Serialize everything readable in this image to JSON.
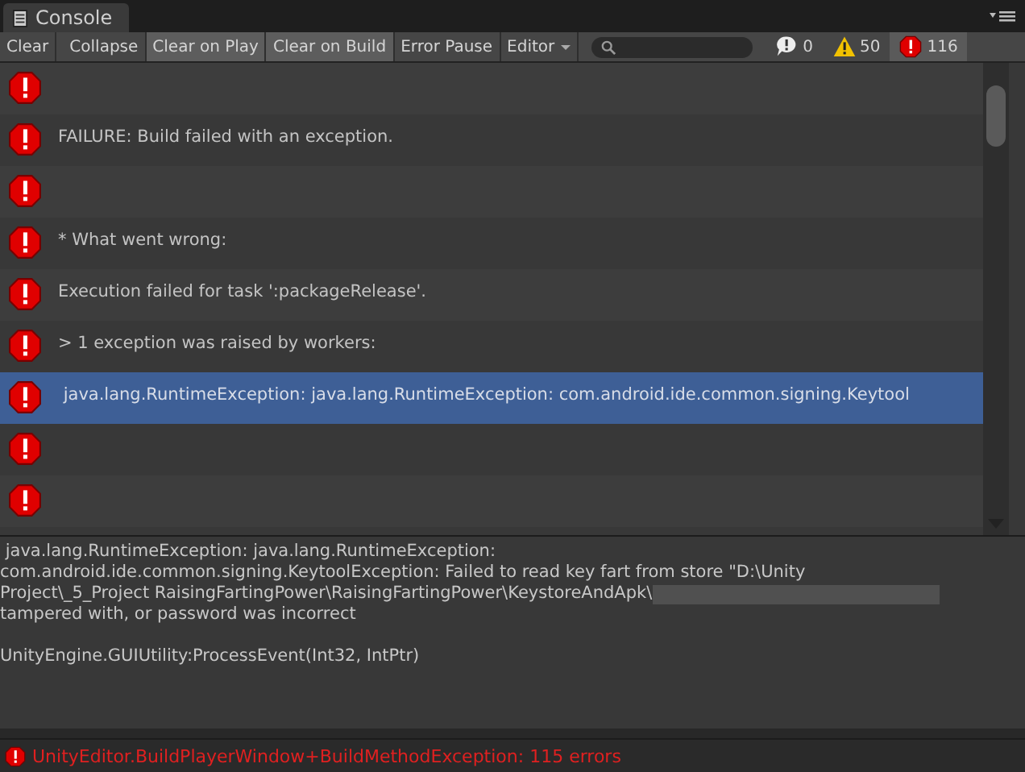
{
  "window": {
    "title": "Console"
  },
  "toolbar": {
    "buttons": [
      {
        "label": "Clear",
        "kind": "button",
        "selected": false
      },
      {
        "label": "Collapse",
        "kind": "toggle",
        "selected": false
      },
      {
        "label": "Clear on Play",
        "kind": "toggle",
        "selected": true
      },
      {
        "label": "Clear on Build",
        "kind": "toggle",
        "selected": true
      },
      {
        "label": "Error Pause",
        "kind": "toggle",
        "selected": false
      },
      {
        "label": "Editor",
        "kind": "dropdown",
        "selected": false
      }
    ],
    "counters": [
      {
        "kind": "info",
        "count": "0",
        "selected": false
      },
      {
        "kind": "warning",
        "count": "50",
        "selected": false
      },
      {
        "kind": "error",
        "count": "116",
        "selected": true
      }
    ]
  },
  "log": {
    "rows": [
      {
        "kind": "error",
        "message": "",
        "selected": false
      },
      {
        "kind": "error",
        "message": "FAILURE: Build failed with an exception.",
        "selected": false
      },
      {
        "kind": "error",
        "message": "",
        "selected": false
      },
      {
        "kind": "error",
        "message": "* What went wrong:",
        "selected": false
      },
      {
        "kind": "error",
        "message": "Execution failed for task ':packageRelease'.",
        "selected": false
      },
      {
        "kind": "error",
        "message": "> 1 exception was raised by workers:",
        "selected": false
      },
      {
        "kind": "error",
        "message": " java.lang.RuntimeException: java.lang.RuntimeException: com.android.ide.common.signing.Keytool",
        "selected": true
      },
      {
        "kind": "error",
        "message": "",
        "selected": false
      },
      {
        "kind": "error",
        "message": "",
        "selected": false
      }
    ]
  },
  "detail": {
    "paragraphs": [
      [
        {
          "text": " java.lang.RuntimeException: java.lang.RuntimeException:",
          "redacted": false
        },
        {
          "text": "com.android.ide.common.signing.KeytoolException: Failed to read key fart from store \"D:\\Unity",
          "redacted": false
        },
        {
          "text": "Project\\_5_Project RaisingFartingPower\\RaisingFartingPower\\KeystoreAndApk\\",
          "redacted": true
        },
        {
          "text": "tampered with, or password was incorrect",
          "redacted": false
        }
      ],
      [
        {
          "text": "UnityEngine.GUIUtility:ProcessEvent(Int32, IntPtr)",
          "redacted": false
        }
      ]
    ]
  },
  "status_bar": {
    "kind": "error",
    "message": "UnityEditor.BuildPlayerWindow+BuildMethodException: 115 errors"
  }
}
